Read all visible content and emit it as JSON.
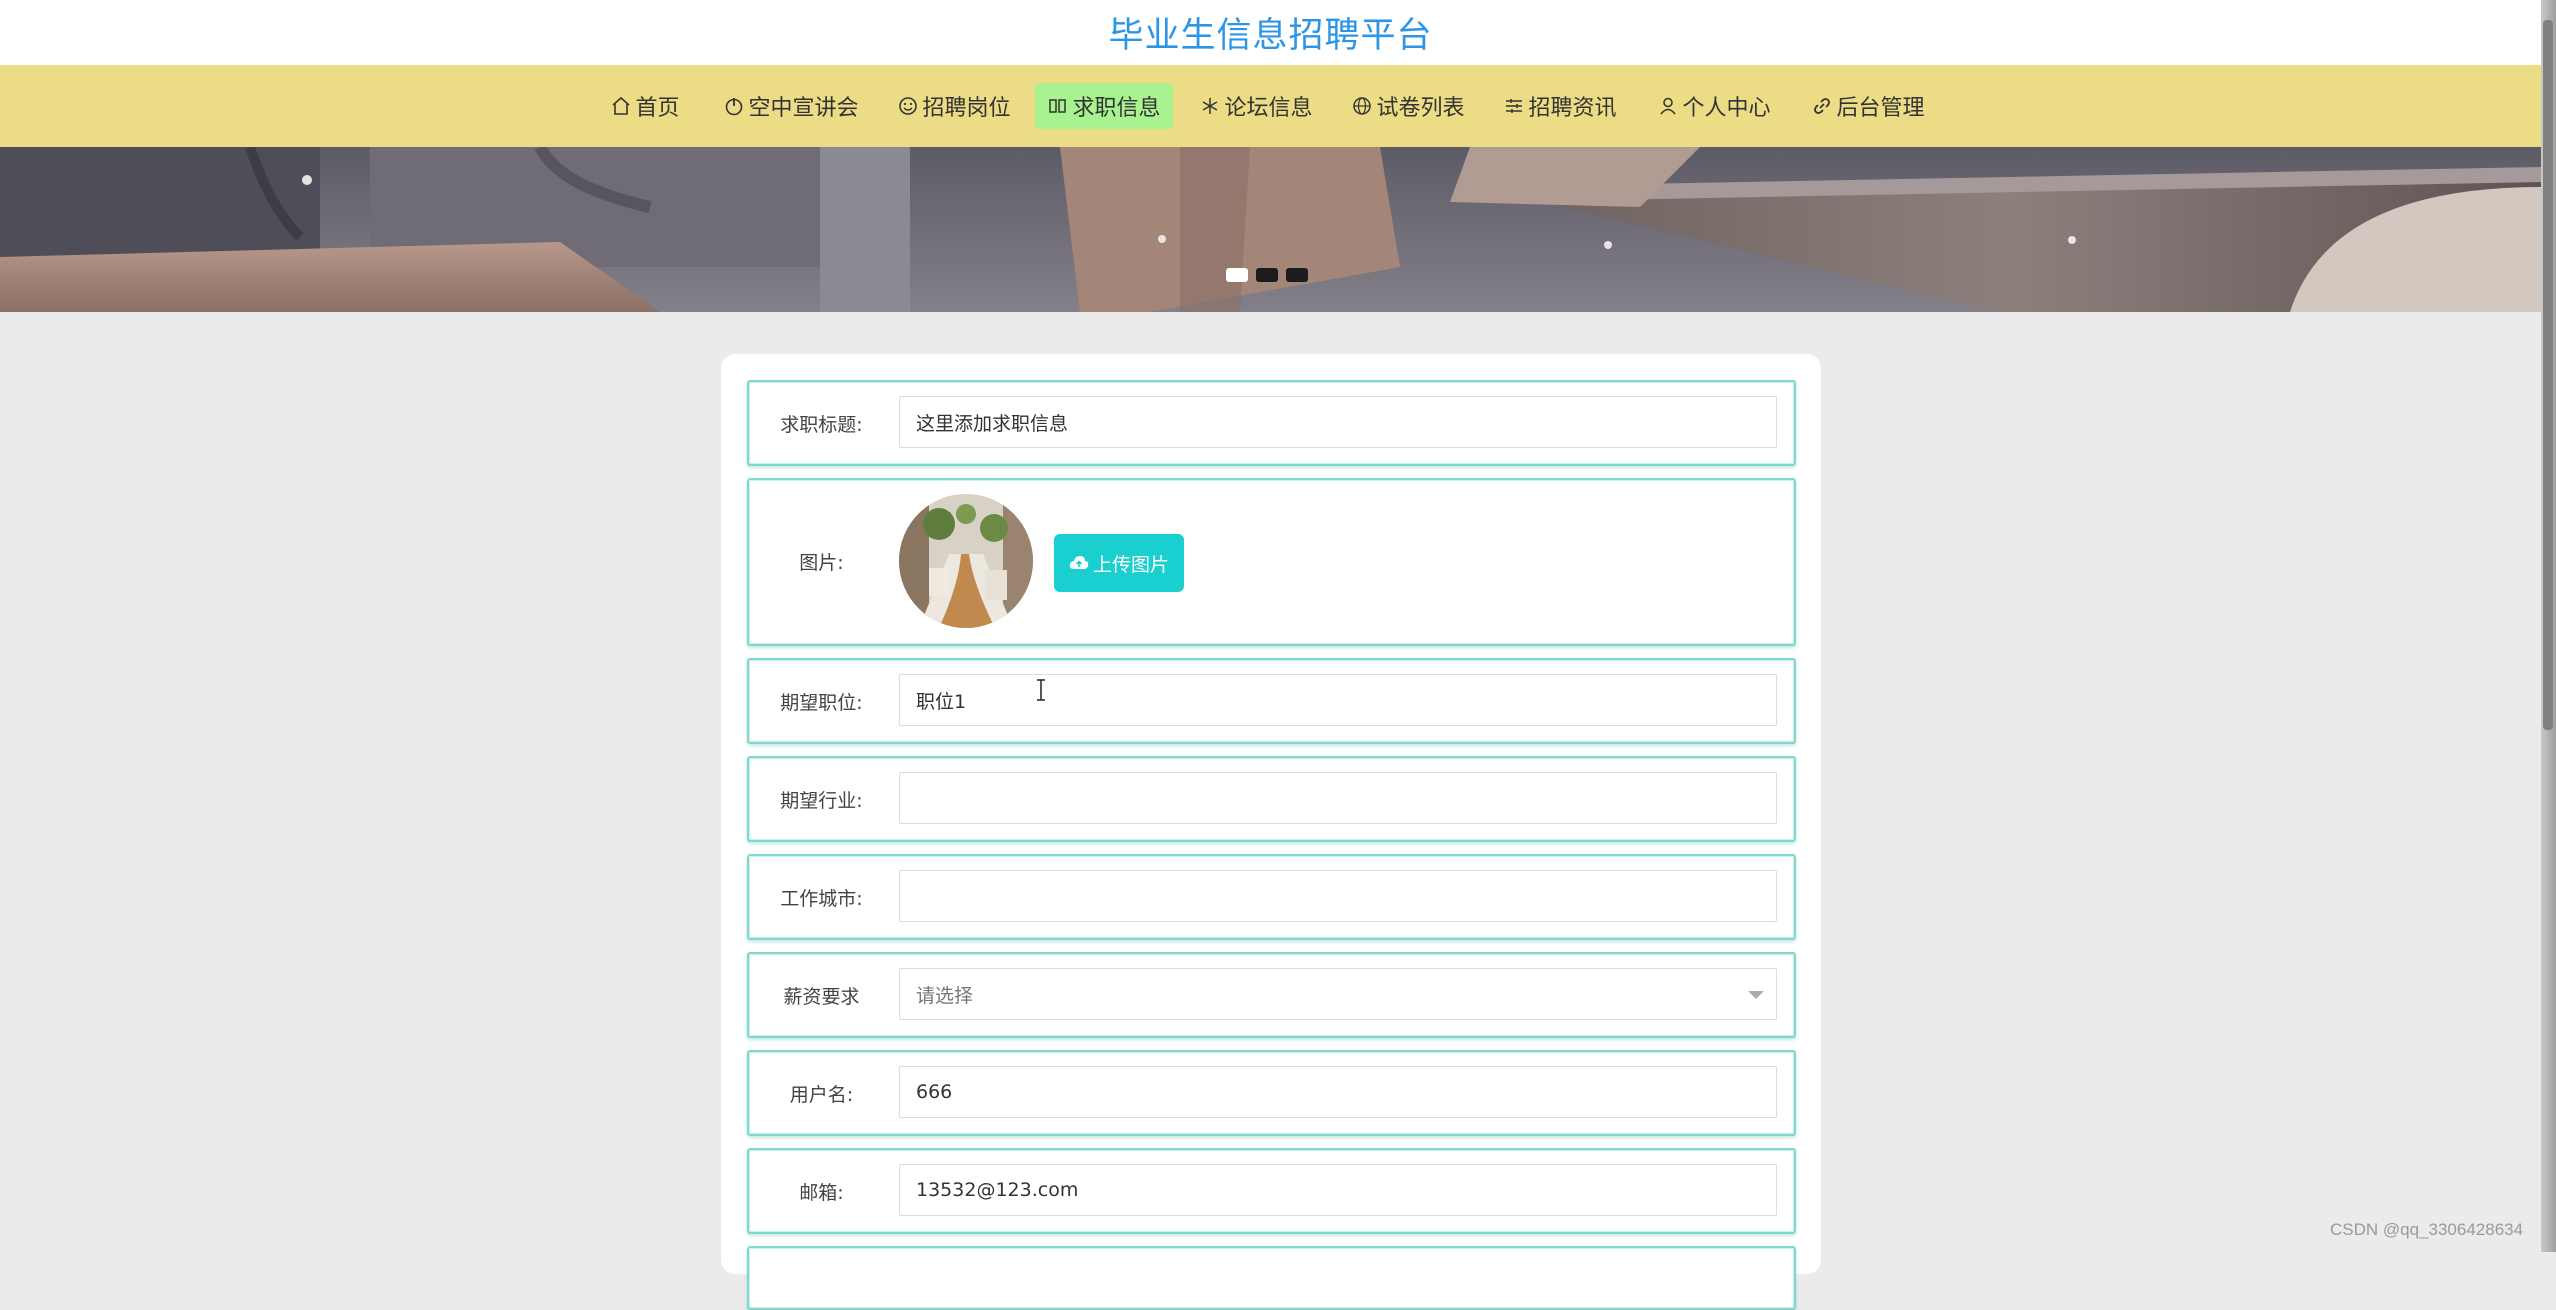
{
  "site_title": "毕业生信息招聘平台",
  "nav": {
    "items": [
      {
        "label": "首页",
        "icon": "home-icon"
      },
      {
        "label": "空中宣讲会",
        "icon": "power-icon"
      },
      {
        "label": "招聘岗位",
        "icon": "smile-icon"
      },
      {
        "label": "求职信息",
        "icon": "columns-icon",
        "active": true
      },
      {
        "label": "论坛信息",
        "icon": "snowflake-icon"
      },
      {
        "label": "试卷列表",
        "icon": "globe-icon"
      },
      {
        "label": "招聘资讯",
        "icon": "sliders-icon"
      },
      {
        "label": "个人中心",
        "icon": "user-icon"
      },
      {
        "label": "后台管理",
        "icon": "link-icon"
      }
    ],
    "active_color": "#a8f28f",
    "bar_color": "#ebdc85"
  },
  "banner": {
    "slide_count": 3,
    "active_index": 0
  },
  "form": {
    "title": {
      "label": "求职标题:",
      "value": "这里添加求职信息"
    },
    "image": {
      "label": "图片:",
      "upload_label": "上传图片"
    },
    "position": {
      "label": "期望职位:",
      "value": "职位1"
    },
    "industry": {
      "label": "期望行业:",
      "value": ""
    },
    "city": {
      "label": "工作城市:",
      "value": ""
    },
    "salary": {
      "label": "薪资要求",
      "placeholder": "请选择"
    },
    "username": {
      "label": "用户名:",
      "value": "666"
    },
    "email": {
      "label": "邮箱:",
      "value": "13532@123.com"
    }
  },
  "watermark": "CSDN @qq_3306428634",
  "colors": {
    "title_blue": "#2d95e5",
    "upload_button": "#19cfcf",
    "field_border": "#7fd8c9"
  }
}
